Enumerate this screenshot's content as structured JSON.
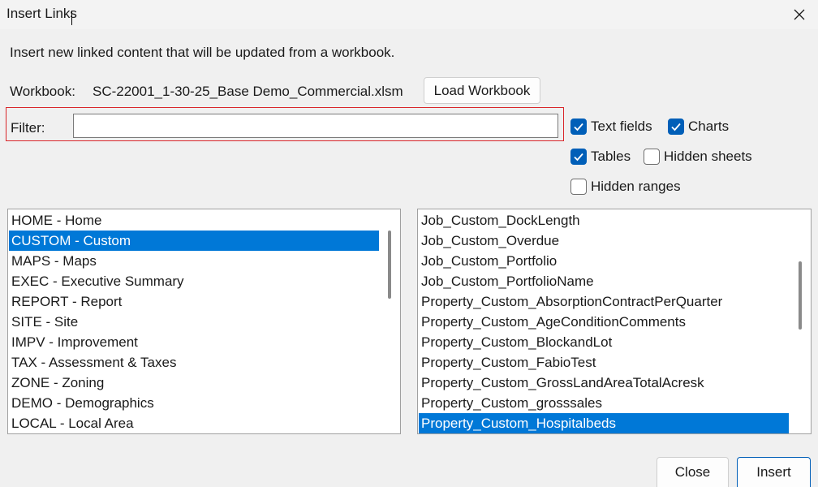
{
  "window": {
    "title": "Insert Links"
  },
  "intro_text": "Insert new linked content that will be updated from a workbook.",
  "workbook": {
    "label": "Workbook:",
    "name": "SC-22001_1-30-25_Base Demo_Commercial.xlsm",
    "load_button": "Load Workbook"
  },
  "filter": {
    "label": "Filter:",
    "value": ""
  },
  "checkboxes": [
    {
      "label": "Text fields",
      "checked": true
    },
    {
      "label": "Charts",
      "checked": true
    },
    {
      "label": "Tables",
      "checked": true
    },
    {
      "label": "Hidden sheets",
      "checked": false
    },
    {
      "label": "Hidden ranges",
      "checked": false
    }
  ],
  "sheets": [
    "HOME - Home",
    "CUSTOM - Custom",
    "MAPS - Maps",
    "EXEC - Executive Summary",
    "REPORT - Report",
    "SITE - Site",
    "IMPV - Improvement",
    "TAX - Assessment & Taxes",
    "ZONE - Zoning",
    "DEMO - Demographics",
    "LOCAL - Local Area"
  ],
  "sheets_selected": "CUSTOM - Custom",
  "fields": [
    "Job_Custom_DockLength",
    "Job_Custom_Overdue",
    "Job_Custom_Portfolio",
    "Job_Custom_PortfolioName",
    "Property_Custom_AbsorptionContractPerQuarter",
    "Property_Custom_AgeConditionComments",
    "Property_Custom_BlockandLot",
    "Property_Custom_FabioTest",
    "Property_Custom_GrossLandAreaTotalAcresk",
    "Property_Custom_grosssales",
    "Property_Custom_Hospitalbeds"
  ],
  "fields_selected": "Property_Custom_Hospitalbeds",
  "buttons": {
    "close": "Close",
    "insert": "Insert"
  },
  "colors": {
    "accent": "#0078d7",
    "checkbox": "#005fb8",
    "highlight_border": "#d9262a"
  },
  "icons": {
    "close": "close-icon",
    "check": "checkmark-icon"
  }
}
